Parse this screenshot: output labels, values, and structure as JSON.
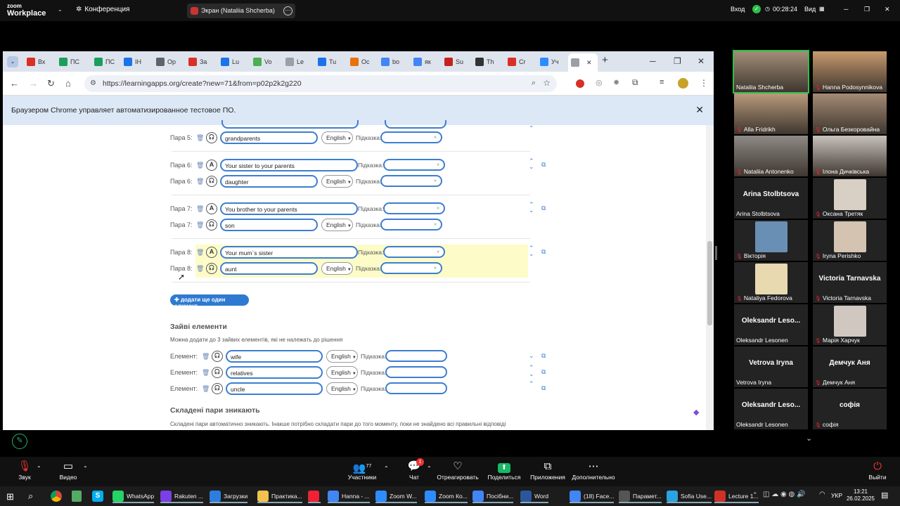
{
  "zoom_top": {
    "logo_line1": "zoom",
    "logo_line2": "Workplace",
    "conference": "Конференция",
    "screen_share": "Экран (Nataliia Shcherba)",
    "login": "Вход",
    "timer": "00:28:24",
    "view": "Вид"
  },
  "browser": {
    "tabs": [
      {
        "label": "Вх",
        "color": "#d93025"
      },
      {
        "label": "ПС",
        "color": "#1a9e5c"
      },
      {
        "label": "ПС",
        "color": "#1a9e5c"
      },
      {
        "label": "ІН",
        "color": "#1a73e8"
      },
      {
        "label": "Ор",
        "color": "#5f6368"
      },
      {
        "label": "За",
        "color": "#d93025"
      },
      {
        "label": "Lu",
        "color": "#1a73e8"
      },
      {
        "label": "Vo",
        "color": "#4caf50"
      },
      {
        "label": "Le",
        "color": "#9aa0a6"
      },
      {
        "label": "Tu",
        "color": "#1a73e8"
      },
      {
        "label": "Ос",
        "color": "#e8710a"
      },
      {
        "label": "bo",
        "color": "#4285f4"
      },
      {
        "label": "як",
        "color": "#4285f4"
      },
      {
        "label": "Su",
        "color": "#c5221f"
      },
      {
        "label": "Th",
        "color": "#333333"
      },
      {
        "label": "Cr",
        "color": "#d93025"
      },
      {
        "label": "Уч",
        "color": "#2d8cff"
      },
      {
        "label": "",
        "color": "#9aa0a6"
      }
    ],
    "url": "https://learningapps.org/create?new=71&from=p02p2k2g220",
    "infobar": "Браузером Chrome управляет автоматизированное тестовое ПО."
  },
  "pairs": [
    {
      "a_label": "",
      "a_text": "",
      "b_label": "Пара 5:",
      "b_text": "grandparents"
    },
    {
      "a_label": "Пара 6:",
      "a_text": "Your sister to your parents",
      "b_label": "Пара 6:",
      "b_text": "daughter"
    },
    {
      "a_label": "Пара 7:",
      "a_text": "You brother to your parents",
      "b_label": "Пара 7:",
      "b_text": "son"
    },
    {
      "a_label": "Пара 8:",
      "a_text": "Your mum`s sister",
      "b_label": "Пара 8:",
      "b_text": "aunt"
    }
  ],
  "common": {
    "lang": "English",
    "hint_label": "Підказка:",
    "text_icon": "A",
    "hint_btn": "«"
  },
  "add_button": "додати ще один елемент",
  "extra": {
    "title": "Зайві елементи",
    "subtitle": "Можна додати до 3 зайвих елементів, які не належать до рішення",
    "label": "Елемент:",
    "items": [
      "wife",
      "relatives",
      "uncle"
    ]
  },
  "vanish": {
    "title": "Складені пари зникають",
    "subtitle": "Складені пари автоматично зникають. Інакше потрібно складати пари до того моменту, поки не знайдено всі правильні відповіді"
  },
  "participants": [
    {
      "name": "Nataliia Shcherba",
      "kind": "video",
      "big": ""
    },
    {
      "name": "Hanna Podosynnikova",
      "kind": "video",
      "big": ""
    },
    {
      "name": "Alla Fridrikh",
      "kind": "video",
      "big": ""
    },
    {
      "name": "Ольга Безкоровайна",
      "kind": "video",
      "big": ""
    },
    {
      "name": "Nataliia Antonenko",
      "kind": "video",
      "big": ""
    },
    {
      "name": "Ілона Дичківська",
      "kind": "video",
      "big": ""
    },
    {
      "name": "Arina Stolbtsova",
      "kind": "name",
      "big": "Arina Stolbtsova"
    },
    {
      "name": "Оксана Третяк",
      "kind": "photo",
      "big": ""
    },
    {
      "name": "Вікторія",
      "kind": "photo",
      "big": ""
    },
    {
      "name": "Iryna Perishko",
      "kind": "photo",
      "big": ""
    },
    {
      "name": "Nataliya Fedorova",
      "kind": "photo",
      "big": ""
    },
    {
      "name": "Victoria Tarnavska",
      "kind": "name",
      "big": "Victoria Tarnavska"
    },
    {
      "name": "Oleksandr Lesonen",
      "kind": "name",
      "big": "Oleksandr Leso..."
    },
    {
      "name": "Марія Харчук",
      "kind": "photo",
      "big": ""
    },
    {
      "name": "Vetrova Iryna",
      "kind": "name",
      "big": "Vetrova Iryna"
    },
    {
      "name": "Демчук Аня",
      "kind": "name",
      "big": "Демчук Аня"
    },
    {
      "name": "Oleksandr Lesonen",
      "kind": "name",
      "big": "Oleksandr Leso..."
    },
    {
      "name": "софія",
      "kind": "name",
      "big": "софія"
    }
  ],
  "zoom_bar": {
    "audio": "Звук",
    "video": "Видео",
    "participants": "Участники",
    "participants_count": "77",
    "chat": "Чат",
    "chat_badge": "1",
    "react": "Отреагировать",
    "share": "Поделиться",
    "apps": "Приложения",
    "more": "Дополнительно",
    "leave": "Выйти"
  },
  "taskbar": {
    "items": [
      {
        "label": "WhatsApp",
        "color": "#25d366"
      },
      {
        "label": "Rakuten ...",
        "color": "#7b3fe4"
      },
      {
        "label": "Загрузки",
        "color": "#2d7de0"
      },
      {
        "label": "Практика...",
        "color": "#f2c14e"
      },
      {
        "label": "",
        "color": "#e23"
      },
      {
        "label": "Hanna - ...",
        "color": "#4285f4"
      },
      {
        "label": "Zoom W...",
        "color": "#2d8cff"
      },
      {
        "label": "Zoom Ко...",
        "color": "#2d8cff"
      },
      {
        "label": "Посібни...",
        "color": "#4285f4"
      },
      {
        "label": "Word",
        "color": "#2b579a"
      },
      {
        "label": "(18) Face...",
        "color": "#4285f4"
      },
      {
        "label": "Парамет...",
        "color": "#555555"
      },
      {
        "label": "Sofia Use...",
        "color": "#2aa3e0"
      },
      {
        "label": "Lecture 1...",
        "color": "#d0302a"
      }
    ],
    "lang": "УКР",
    "time": "13:21",
    "date": "26.02.2025"
  }
}
